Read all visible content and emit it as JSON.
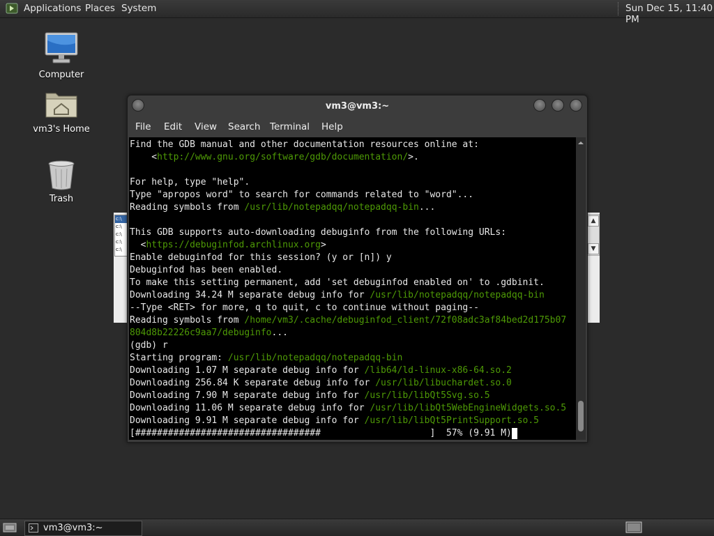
{
  "top_panel": {
    "menus": [
      "Applications",
      "Places",
      "System"
    ],
    "clock": "Sun Dec 15, 11:40 PM"
  },
  "desktop": {
    "icons": [
      {
        "label": "Computer",
        "icon": "computer-icon"
      },
      {
        "label": "vm3's Home",
        "icon": "home-folder-icon"
      },
      {
        "label": "Trash",
        "icon": "trash-icon"
      }
    ]
  },
  "background_window": {
    "list_items": [
      "c:\\",
      "c:\\",
      "c:\\",
      "c:\\",
      "c:\\"
    ]
  },
  "terminal": {
    "title": "vm3@vm3:~",
    "menu": [
      "File",
      "Edit",
      "View",
      "Search",
      "Terminal",
      "Help"
    ],
    "lines": [
      [
        {
          "t": "Find the GDB manual and other documentation resources online at:"
        }
      ],
      [
        {
          "t": "    <"
        },
        {
          "t": "http://www.gnu.org/software/gdb/documentation/",
          "u": true
        },
        {
          "t": ">."
        }
      ],
      [
        {
          "t": ""
        }
      ],
      [
        {
          "t": "For help, type \"help\"."
        }
      ],
      [
        {
          "t": "Type \"apropos word\" to search for commands related to \"word\"..."
        }
      ],
      [
        {
          "t": "Reading symbols from "
        },
        {
          "t": "/usr/lib/notepadqq/notepadqq-bin",
          "u": true
        },
        {
          "t": "..."
        }
      ],
      [
        {
          "t": ""
        }
      ],
      [
        {
          "t": "This GDB supports auto-downloading debuginfo from the following URLs:"
        }
      ],
      [
        {
          "t": "  <"
        },
        {
          "t": "https://debuginfod.archlinux.org",
          "u": true
        },
        {
          "t": ">"
        }
      ],
      [
        {
          "t": "Enable debuginfod for this session? (y or [n]) y"
        }
      ],
      [
        {
          "t": "Debuginfod has been enabled."
        }
      ],
      [
        {
          "t": "To make this setting permanent, add 'set debuginfod enabled on' to .gdbinit."
        }
      ],
      [
        {
          "t": "Downloading 34.24 M separate debug info for "
        },
        {
          "t": "/usr/lib/notepadqq/notepadqq-bin",
          "u": true
        }
      ],
      [
        {
          "t": "--Type <RET> for more, q to quit, c to continue without paging--"
        }
      ],
      [
        {
          "t": "Reading symbols from "
        },
        {
          "t": "/home/vm3/.cache/debuginfod_client/72f08adc3af84bed2d175b07",
          "u": true
        }
      ],
      [
        {
          "t": "804d8b22226c9aa7/debuginfo",
          "u": true
        },
        {
          "t": "..."
        }
      ],
      [
        {
          "t": "(gdb) r"
        }
      ],
      [
        {
          "t": "Starting program: "
        },
        {
          "t": "/usr/lib/notepadqq/notepadqq-bin",
          "u": true
        }
      ],
      [
        {
          "t": "Downloading 1.07 M separate debug info for "
        },
        {
          "t": "/lib64/ld-linux-x86-64.so.2",
          "u": true
        }
      ],
      [
        {
          "t": "Downloading 256.84 K separate debug info for "
        },
        {
          "t": "/usr/lib/libuchardet.so.0",
          "u": true
        }
      ],
      [
        {
          "t": "Downloading 7.90 M separate debug info for "
        },
        {
          "t": "/usr/lib/libQt5Svg.so.5",
          "u": true
        }
      ],
      [
        {
          "t": "Downloading 11.06 M separate debug info for "
        },
        {
          "t": "/usr/lib/libQt5WebEngineWidgets.so.5",
          "u": true
        }
      ],
      [
        {
          "t": "Downloading 9.91 M separate debug info for "
        },
        {
          "t": "/usr/lib/libQt5PrintSupport.so.5",
          "u": true
        }
      ],
      [
        {
          "t": "[##################################                    ]  57% (9.91 M)"
        }
      ]
    ]
  },
  "taskbar": {
    "window_button": "vm3@vm3:~"
  }
}
